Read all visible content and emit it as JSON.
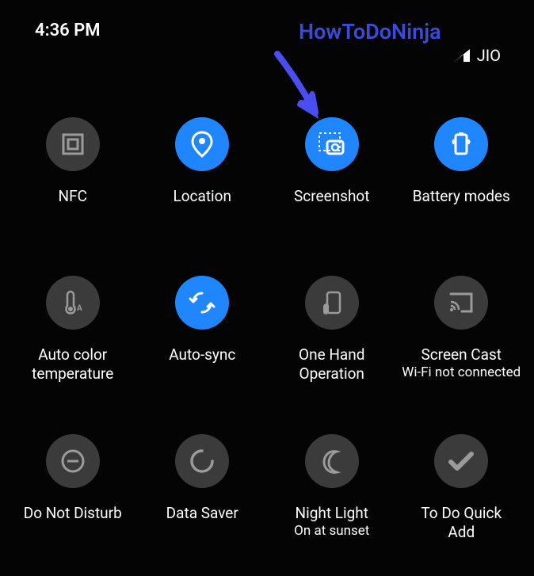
{
  "status": {
    "time": "4:36 PM",
    "carrier": "JIO"
  },
  "watermark": "HowToDoNinja",
  "tiles": [
    {
      "id": "nfc",
      "label": "NFC",
      "sub": "",
      "on": false,
      "icon": "nfc"
    },
    {
      "id": "location",
      "label": "Location",
      "sub": "",
      "on": true,
      "icon": "location"
    },
    {
      "id": "screenshot",
      "label": "Screenshot",
      "sub": "",
      "on": true,
      "icon": "screenshot"
    },
    {
      "id": "battery",
      "label": "Battery modes",
      "sub": "",
      "on": true,
      "icon": "battery"
    },
    {
      "id": "autocolor",
      "label": "Auto color\ntemperature",
      "sub": "",
      "on": false,
      "icon": "thermometer"
    },
    {
      "id": "autosync",
      "label": "Auto-sync",
      "sub": "",
      "on": true,
      "icon": "sync"
    },
    {
      "id": "onehand",
      "label": "One Hand\nOperation",
      "sub": "",
      "on": false,
      "icon": "onehand"
    },
    {
      "id": "screencast",
      "label": "Screen Cast",
      "sub": "Wi-Fi not connected",
      "on": false,
      "icon": "cast"
    },
    {
      "id": "dnd",
      "label": "Do Not Disturb",
      "sub": "",
      "on": false,
      "icon": "dnd"
    },
    {
      "id": "datasaver",
      "label": "Data Saver",
      "sub": "",
      "on": false,
      "icon": "datasaver"
    },
    {
      "id": "nightlight",
      "label": "Night Light",
      "sub": "On at sunset",
      "on": false,
      "icon": "moon"
    },
    {
      "id": "todo",
      "label": "To Do Quick\nAdd",
      "sub": "",
      "on": false,
      "icon": "check"
    }
  ],
  "chart_data": null
}
